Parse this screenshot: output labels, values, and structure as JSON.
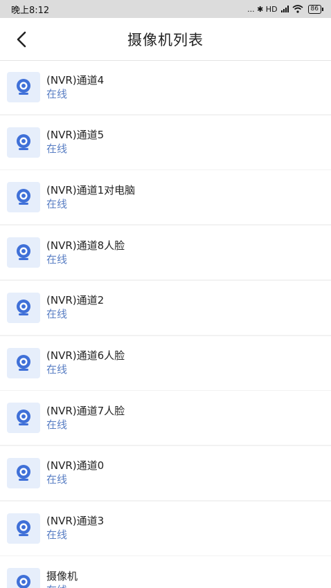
{
  "status_bar": {
    "time": "晚上8:12",
    "indicators": "... ✱ HD",
    "battery": "86",
    "icons": [
      "bluetooth-icon",
      "signal-icon",
      "wifi-icon",
      "battery-icon"
    ]
  },
  "header": {
    "title": "摄像机列表",
    "back_icon": "chevron-left-icon"
  },
  "theme": {
    "status_color": "#5a7fc4",
    "icon_bg": "#e6eefb",
    "icon_color": "#3f70d8"
  },
  "cameras": [
    {
      "name": "(NVR)通道4",
      "status": "在线"
    },
    {
      "name": "(NVR)通道5",
      "status": "在线"
    },
    {
      "name": "(NVR)通道1对电脑",
      "status": "在线"
    },
    {
      "name": "(NVR)通道8人脸",
      "status": "在线"
    },
    {
      "name": "(NVR)通道2",
      "status": "在线"
    },
    {
      "name": "(NVR)通道6人脸",
      "status": "在线"
    },
    {
      "name": "(NVR)通道7人脸",
      "status": "在线"
    },
    {
      "name": "(NVR)通道0",
      "status": "在线"
    },
    {
      "name": "(NVR)通道3",
      "status": "在线"
    },
    {
      "name": "摄像机",
      "status": "在线"
    }
  ]
}
